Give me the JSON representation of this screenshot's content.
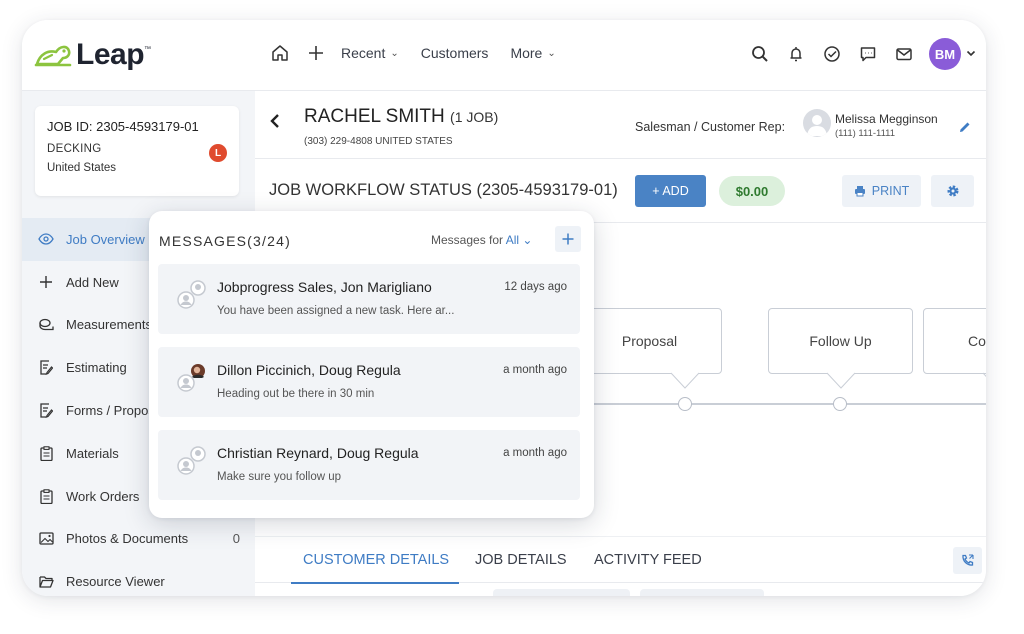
{
  "brand": {
    "name": "Leap",
    "tm": "™",
    "color": "#8cc43f"
  },
  "nav": {
    "recent": "Recent",
    "customers": "Customers",
    "more": "More",
    "user_initials": "BM"
  },
  "job": {
    "id": "JOB ID: 2305-4593179-01",
    "type": "DECKING",
    "country": "United States",
    "badge": "L"
  },
  "sidebar": {
    "items": [
      {
        "label": "Job Overview",
        "icon": "eye-icon"
      },
      {
        "label": "Add New",
        "icon": "plus-icon"
      },
      {
        "label": "Measurements",
        "icon": "measure-icon"
      },
      {
        "label": "Estimating",
        "icon": "document-edit-icon"
      },
      {
        "label": "Forms / Proposals",
        "icon": "document-edit-icon"
      },
      {
        "label": "Materials",
        "icon": "clipboard-icon"
      },
      {
        "label": "Work Orders",
        "icon": "clipboard-icon"
      },
      {
        "label": "Photos & Documents",
        "icon": "image-icon",
        "count": "0"
      },
      {
        "label": "Resource Viewer",
        "icon": "folder-icon"
      }
    ]
  },
  "customer": {
    "name": "RACHEL SMITH",
    "jobs": "(1 JOB)",
    "phone": "(303) 229-4808 UNITED STATES",
    "rep_label": "Salesman / Customer Rep:",
    "rep_name": "Melissa Megginson",
    "rep_phone": "(111) 111-1111"
  },
  "workflow": {
    "title": "JOB WORKFLOW STATUS (2305-4593179-01)",
    "add_label": "+ ADD",
    "amount": "$0.00",
    "print_label": "PRINT",
    "stages": [
      "Proposal",
      "Follow Up",
      "Cont"
    ]
  },
  "tabs": [
    "CUSTOMER DETAILS",
    "JOB DETAILS",
    "ACTIVITY FEED"
  ],
  "messages": {
    "title": "MESSAGES(3/24)",
    "for_label": "Messages for ",
    "for_value": "All",
    "items": [
      {
        "names": "Jobprogress Sales, Jon Marigliano",
        "time": "12 days ago",
        "text": "You have been assigned a new task. Here ar..."
      },
      {
        "names": "Dillon Piccinich, Doug Regula",
        "time": "a month ago",
        "text": "Heading out be there in 30 min"
      },
      {
        "names": "Christian Reynard, Doug Regula",
        "time": "a month ago",
        "text": "Make sure you follow up"
      }
    ]
  },
  "colors": {
    "accent": "#3f7cc4",
    "add_button": "#4a83c5",
    "amount_bg": "#dcf0dc",
    "amount_text": "#2f7a2f",
    "badge": "#e04b2e",
    "avatar": "#8a5cd8"
  }
}
